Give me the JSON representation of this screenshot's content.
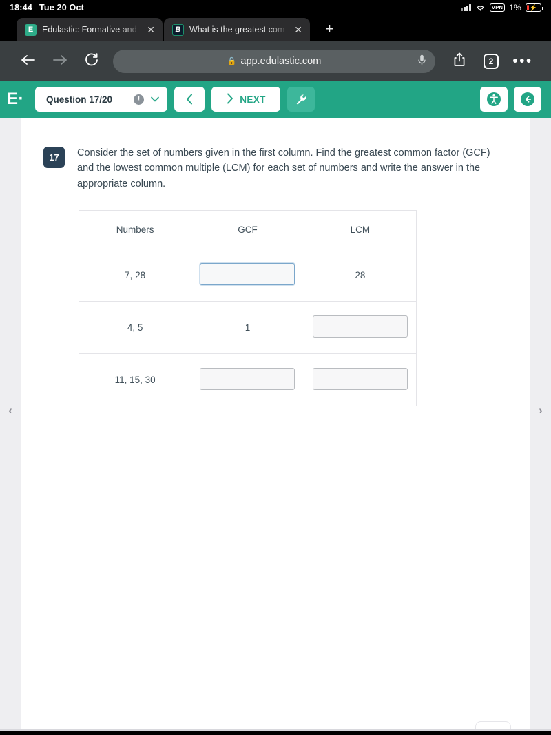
{
  "status_bar": {
    "time": "18:44",
    "date": "Tue 20 Oct",
    "vpn_label": "VPN",
    "battery_percent": "1%",
    "icons": [
      "cellular-signal-icon",
      "wifi-icon",
      "vpn-badge",
      "battery-charging-icon"
    ]
  },
  "browser": {
    "tabs": [
      {
        "favicon_letter": "E",
        "title": "Edulastic: Formative and",
        "close_label": "✕",
        "active": true
      },
      {
        "favicon_letter": "B",
        "title": "What is the greatest com",
        "close_label": "✕",
        "active": false
      }
    ],
    "new_tab_label": "+",
    "toolbar": {
      "back_label": "←",
      "forward_label": "→",
      "reload_label": "↻",
      "url": "app.edulastic.com",
      "lock_label": "🔒",
      "mic_label": "🎙",
      "share_label": "⇧",
      "tab_count": "2",
      "more_label": "•••"
    }
  },
  "app_header": {
    "logo": "E·",
    "question_pill": {
      "label": "Question 17/20",
      "info_label": "!",
      "chevron_label": "∨"
    },
    "prev_label": "‹",
    "next_label": "NEXT",
    "next_icon_label": "›",
    "tool_label": "🔧",
    "accessibility_label": "ф",
    "exit_label": "←",
    "accent_color": "#22a585"
  },
  "question": {
    "number": "17",
    "text": "Consider the set of numbers given in the first column. Find the greatest common factor (GCF)  and the lowest common multiple (LCM) for each set of numbers and write the answer in the appropriate column.",
    "table": {
      "headers": [
        "Numbers",
        "GCF",
        "LCM"
      ],
      "rows": [
        {
          "numbers": "7, 28",
          "gcf": {
            "type": "input",
            "value": "",
            "focused": true
          },
          "lcm": {
            "type": "text",
            "value": "28"
          }
        },
        {
          "numbers": "4, 5",
          "gcf": {
            "type": "text",
            "value": "1"
          },
          "lcm": {
            "type": "input",
            "value": "",
            "focused": false
          }
        },
        {
          "numbers": "11, 15, 30",
          "gcf": {
            "type": "input",
            "value": "",
            "focused": false
          },
          "lcm": {
            "type": "input",
            "value": "",
            "focused": false
          }
        }
      ]
    }
  },
  "page_nav": {
    "prev_label": "‹",
    "next_label": "›"
  }
}
